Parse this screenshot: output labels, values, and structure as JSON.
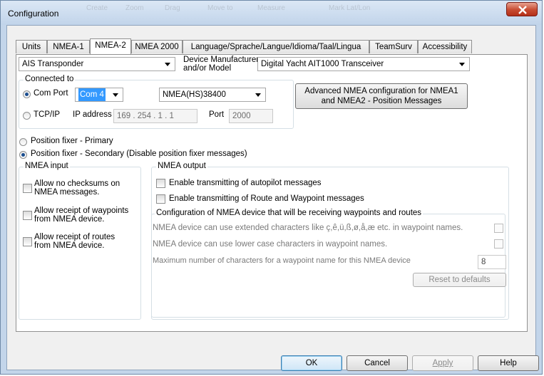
{
  "window": {
    "title": "Configuration",
    "background_ghost": [
      "Create",
      "Zoom",
      "Drag",
      "Move to",
      "Measure",
      "Mark Lat/Lon"
    ]
  },
  "tabs": [
    {
      "label": "Units",
      "active": false
    },
    {
      "label": "NMEA-1",
      "active": false
    },
    {
      "label": "NMEA-2",
      "active": true
    },
    {
      "label": "NMEA 2000",
      "active": false
    },
    {
      "label": "Language/Sprache/Langue/Idioma/Taal/Lingua",
      "active": false
    },
    {
      "label": "TeamSurv",
      "active": false
    },
    {
      "label": "Accessibility",
      "active": false
    }
  ],
  "device": {
    "type_value": "AIS Transponder",
    "manufacturer_label_line1": "Device Manufacturer",
    "manufacturer_label_line2": "and/or Model",
    "manufacturer_value": "Digital Yacht AIT1000 Transceiver"
  },
  "connected": {
    "group_title": "Connected to",
    "com_port_label": "Com Port",
    "com_port_value": "Com 4",
    "protocol_value": "NMEA(HS)38400",
    "tcpip_label": "TCP/IP",
    "ip_label": "IP address",
    "ip_value": "169 . 254 .  1  .  1",
    "port_label": "Port",
    "port_value": "2000",
    "advanced_button_line1": "Advanced NMEA configuration for NMEA1",
    "advanced_button_line2": "and NMEA2 - Position Messages"
  },
  "position_fixer": {
    "primary_label": "Position fixer - Primary",
    "secondary_label": "Position fixer - Secondary (Disable position fixer messages)"
  },
  "nmea_input": {
    "title": "NMEA input",
    "no_checksum_line1": "Allow no checksums on",
    "no_checksum_line2": "NMEA messages.",
    "waypoints_line1": "Allow receipt of waypoints",
    "waypoints_line2": "from NMEA device.",
    "routes_line1": "Allow receipt of routes",
    "routes_line2": "from NMEA device."
  },
  "nmea_output": {
    "title": "NMEA output",
    "autopilot_label": "Enable transmitting of autopilot messages",
    "route_waypoint_label": "Enable transmitting of Route and Waypoint messages",
    "device_config_title": "Configuration of NMEA device that will be receiving waypoints and routes",
    "extended_chars_label": "NMEA device can use extended characters like ç,ê,ü,ß,ø,å,æ etc. in waypoint names.",
    "lowercase_label": "NMEA device can use lower case characters in waypoint names.",
    "max_chars_label": "Maximum number of characters for a waypoint name for this NMEA device",
    "max_chars_value": "8",
    "reset_button": "Reset to defaults"
  },
  "footer": {
    "ok": "OK",
    "cancel": "Cancel",
    "apply": "Apply",
    "help": "Help"
  }
}
